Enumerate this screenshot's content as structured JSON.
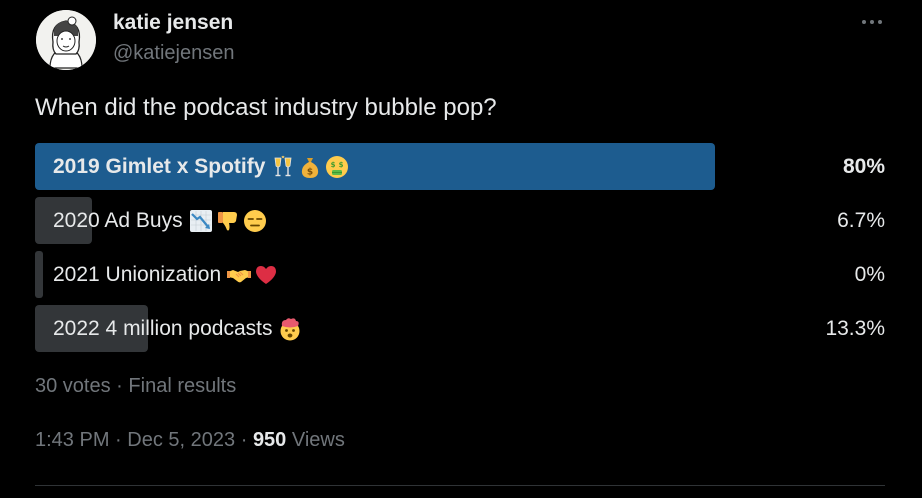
{
  "author": {
    "display_name": "katie jensen",
    "handle": "@katiejensen"
  },
  "tweet_text": "When did the podcast industry bubble pop?",
  "poll": {
    "options": [
      {
        "label": "2019 Gimlet x Spotify",
        "percent": "80%",
        "fraction": 0.8,
        "emojis": [
          "clinking-glasses-icon",
          "money-bag-icon",
          "money-mouth-face-icon"
        ]
      },
      {
        "label": "2020 Ad Buys",
        "percent": "6.7%",
        "fraction": 0.067,
        "emojis": [
          "chart-decreasing-icon",
          "thumbs-down-icon",
          "expressionless-face-icon"
        ]
      },
      {
        "label": "2021 Unionization",
        "percent": "0%",
        "fraction": 0.0,
        "emojis": [
          "handshake-icon",
          "red-heart-icon"
        ]
      },
      {
        "label": "2022 4 million podcasts",
        "percent": "13.3%",
        "fraction": 0.133,
        "emojis": [
          "exploding-head-icon"
        ]
      }
    ],
    "votes_text": "30 votes",
    "separator": "·",
    "status_text": "Final results"
  },
  "meta": {
    "time": "1:43 PM",
    "date": "Dec 5, 2023",
    "views_count": "950",
    "views_label": "Views",
    "separator": "·"
  },
  "colors": {
    "background": "#000000",
    "winner_bar": "#1d5c8f",
    "bar": "#333639",
    "text": "#e7e9ea",
    "secondary_text": "#71767b"
  }
}
